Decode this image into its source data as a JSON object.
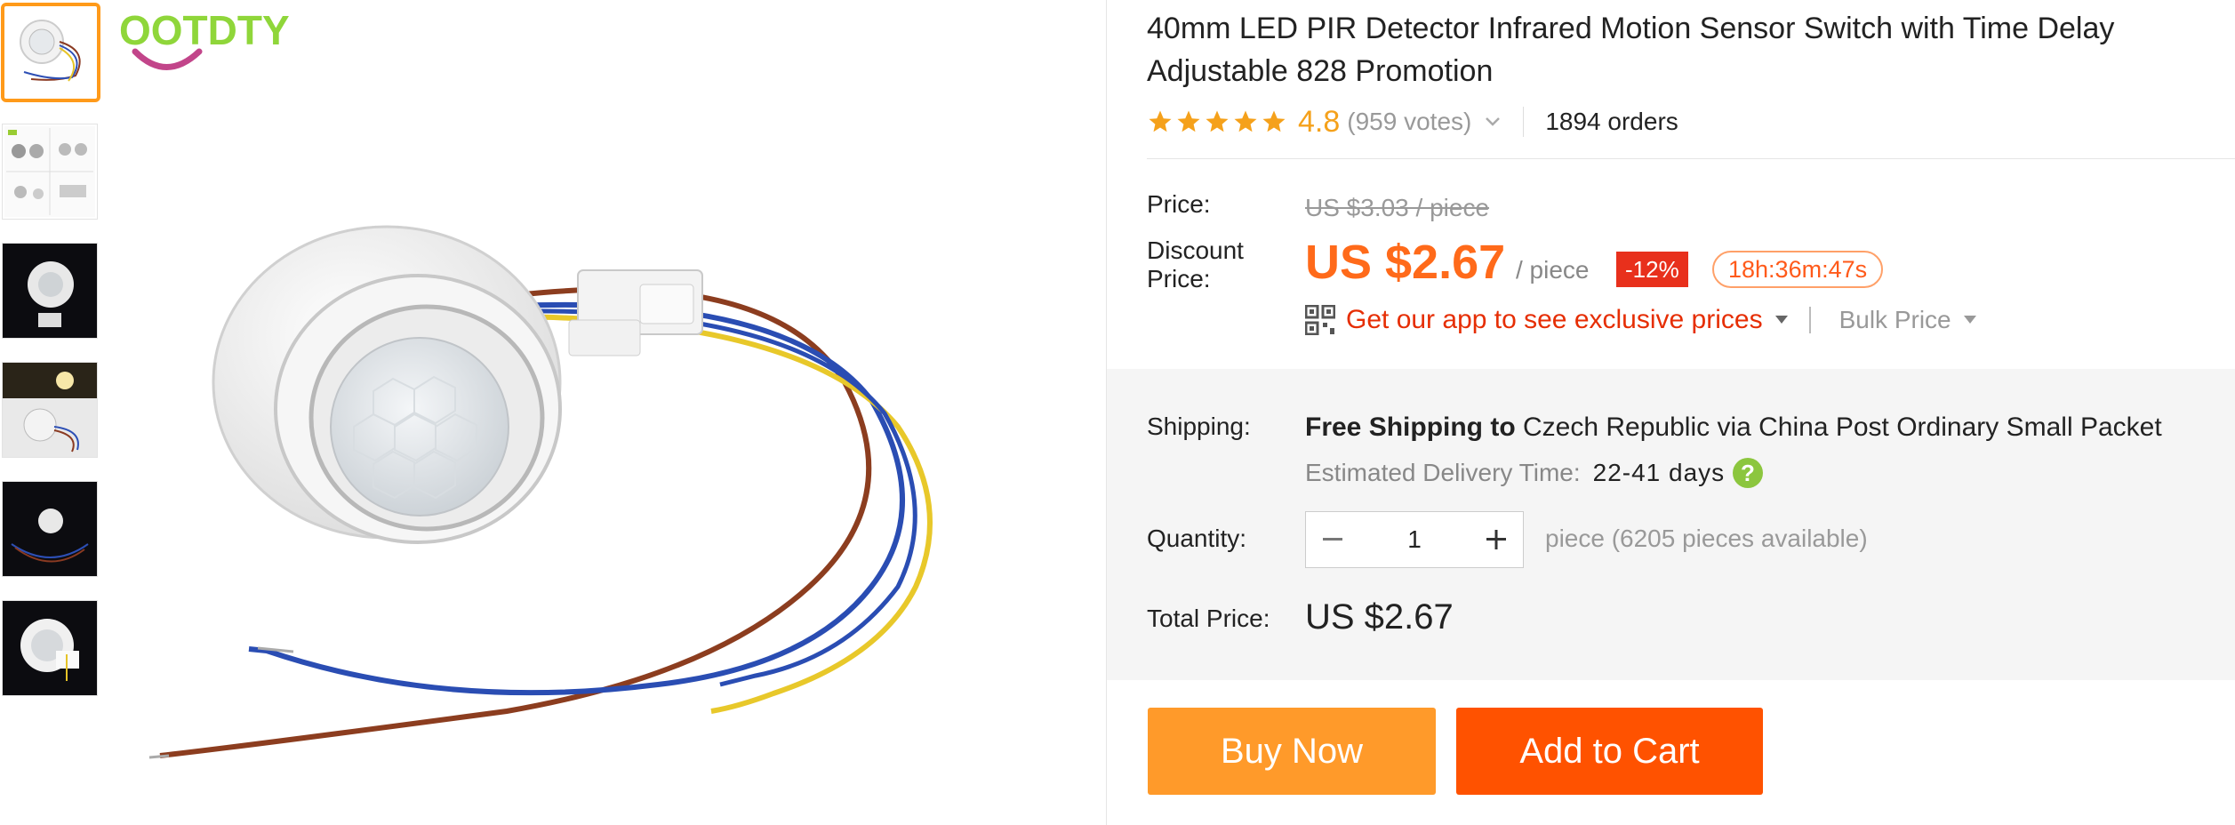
{
  "brand": {
    "logo_text": "OOTDTY",
    "logo_color": "#8fd63a",
    "smile_color": "#c2458a"
  },
  "thumbnails": [
    {
      "name": "thumb-sensor-white",
      "selected": true
    },
    {
      "name": "thumb-diagram"
    },
    {
      "name": "thumb-dark-1"
    },
    {
      "name": "thumb-light-demo"
    },
    {
      "name": "thumb-dark-2"
    },
    {
      "name": "thumb-dark-3"
    }
  ],
  "product": {
    "title": "40mm LED PIR Detector Infrared Motion Sensor Switch with Time Delay Adjustable 828 Promotion",
    "rating": "4.8",
    "votes": "(959 votes)",
    "orders": "1894 orders",
    "stars": 5
  },
  "price": {
    "price_label": "Price:",
    "old_price": "US $3.03 / piece",
    "discount_label_line1": "Discount",
    "discount_label_line2": "Price:",
    "new_price": "US $2.67",
    "per_piece": "/ piece",
    "discount_badge": "-12%",
    "countdown": "18h:36m:47s",
    "app_link": "Get our app to see exclusive prices",
    "bulk_price": "Bulk Price"
  },
  "shipping": {
    "label": "Shipping:",
    "free": "Free Shipping to",
    "details": "Czech Republic via China Post Ordinary Small Packet",
    "est_label": "Estimated Delivery Time:",
    "est_days": "22-41 days"
  },
  "quantity": {
    "label": "Quantity:",
    "value": "1",
    "available": "piece (6205 pieces available)"
  },
  "total": {
    "label": "Total Price:",
    "value": "US $2.67"
  },
  "actions": {
    "buy_now": "Buy Now",
    "add_to_cart": "Add to Cart"
  },
  "colors": {
    "accent_orange": "#ff6a1a",
    "rating_orange": "#f5a11b",
    "discount_red": "#e8301c",
    "app_red": "#e62e04",
    "buy_now_bg": "#ff9a2a",
    "add_to_cart_bg": "#ff5200",
    "help_green": "#8cc63e"
  }
}
